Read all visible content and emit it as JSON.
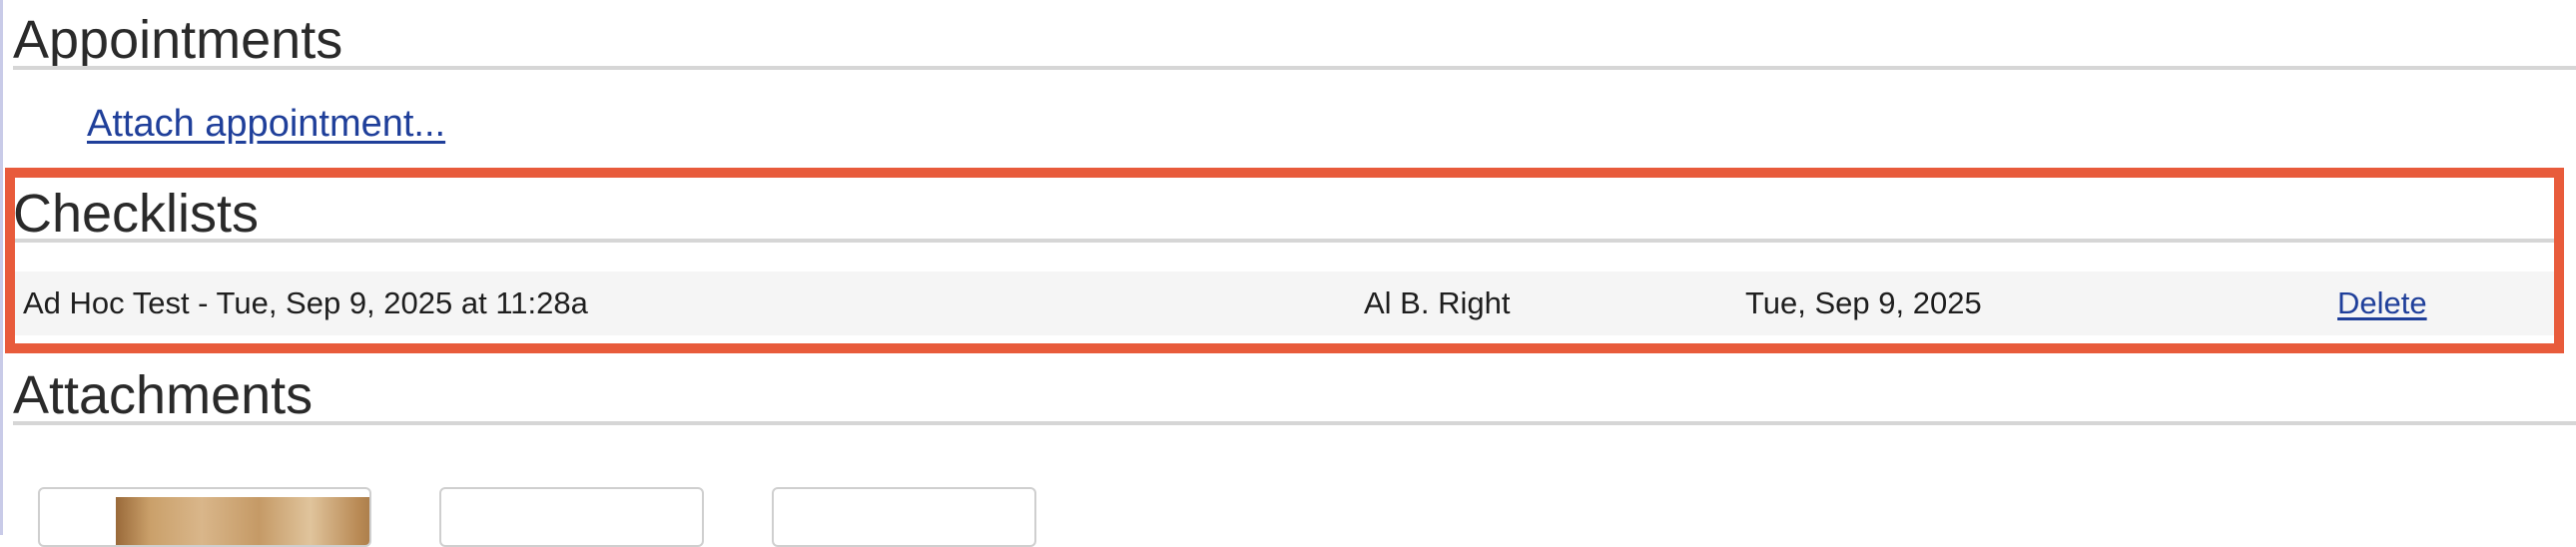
{
  "appointments": {
    "title": "Appointments",
    "attach_link": "Attach appointment..."
  },
  "checklists": {
    "title": "Checklists",
    "rows": [
      {
        "name": "Ad Hoc Test - Tue, Sep 9, 2025 at 11:28a",
        "user": "Al B. Right",
        "date": "Tue, Sep 9, 2025",
        "action": "Delete"
      }
    ]
  },
  "attachments": {
    "title": "Attachments"
  },
  "colors": {
    "highlight": "#e85b3b",
    "link": "#1f3f9a",
    "rule": "#d6d6d6",
    "row_background": "#f5f5f5"
  }
}
